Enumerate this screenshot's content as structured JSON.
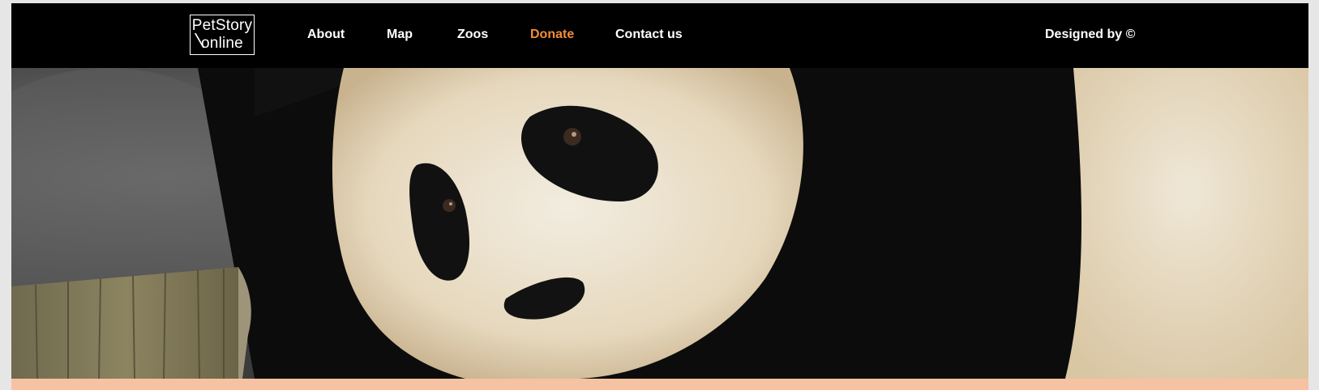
{
  "navbar": {
    "logo_line1": "PetStory",
    "logo_line2": "online",
    "items": [
      {
        "label": "About",
        "active": false
      },
      {
        "label": "Map",
        "active": false
      },
      {
        "label": "Zoos",
        "active": false
      },
      {
        "label": "Donate",
        "active": true
      },
      {
        "label": "Contact us",
        "active": false
      }
    ],
    "credit": "Designed by ©"
  },
  "hero": {
    "image_subject": "giant panda close-up resting head on wooden post"
  },
  "colors": {
    "nav_bg": "#000000",
    "nav_text": "#ffffff",
    "accent": "#f28c3a",
    "bottom_strip": "#f6c2a1"
  }
}
